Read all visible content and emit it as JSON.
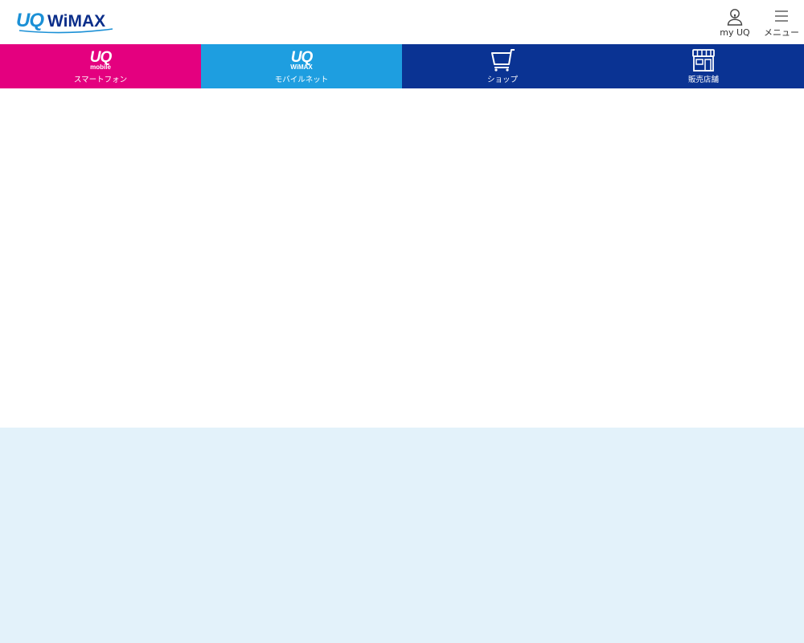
{
  "header": {
    "logo": {
      "uq": "UQ",
      "wimax": "WiMAX"
    },
    "my_uq_label": "my UQ",
    "menu_label": "メニュー"
  },
  "nav": {
    "items": [
      {
        "brand_main": "UQ",
        "brand_sub": "mobile",
        "label": "スマートフォン",
        "color": "#e4007f"
      },
      {
        "brand_main": "UQ",
        "brand_sub": "WiMAX",
        "label": "モバイルネット",
        "color": "#1e9ee0"
      },
      {
        "label": "ショップ",
        "icon": "cart-icon",
        "color": "#0a3393"
      },
      {
        "label": "販売店舗",
        "icon": "store-icon",
        "color": "#0a3393"
      }
    ]
  },
  "colors": {
    "footer_background": "#e3f2fa",
    "logo_blue": "#1b90d6",
    "logo_navy": "#0b2e8a"
  }
}
